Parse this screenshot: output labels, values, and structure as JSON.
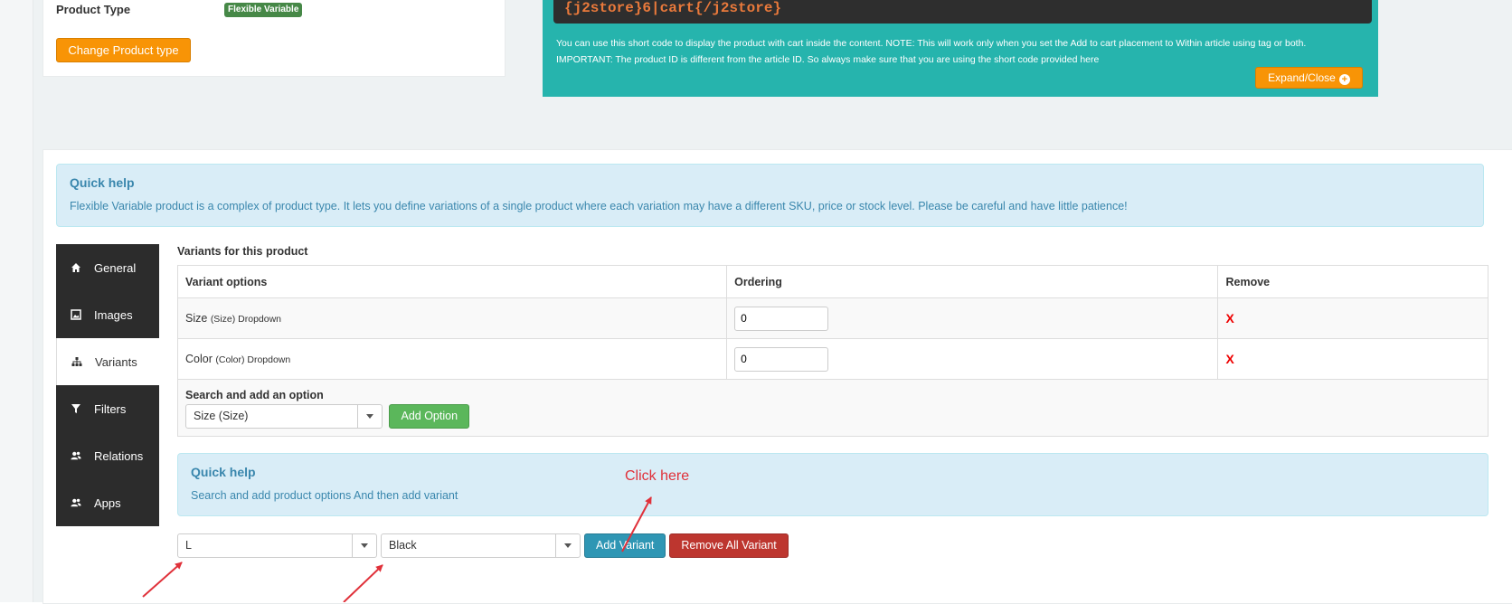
{
  "product_type": {
    "label": "Product Type",
    "badge": "Flexible Variable",
    "change_button": "Change Product type"
  },
  "shortcode": {
    "code": "{j2store}6|cart{/j2store}",
    "note1": "You can use this short code to display the product with cart inside the content. NOTE: This will work only when you set the Add to cart placement to Within article using tag or both.",
    "note2": "IMPORTANT: The product ID is different from the article ID. So always make sure that you are using the short code provided here",
    "expand_button": "Expand/Close"
  },
  "quick_help": {
    "title": "Quick help",
    "text": "Flexible Variable product is a complex of product type. It lets you define variations of a single product where each variation may have a different SKU, price or stock level. Please be careful and have little patience!"
  },
  "nav": [
    {
      "label": "General",
      "icon": "home-icon"
    },
    {
      "label": "Images",
      "icon": "image-icon"
    },
    {
      "label": "Variants",
      "icon": "sitemap-icon",
      "active": true
    },
    {
      "label": "Filters",
      "icon": "filter-icon"
    },
    {
      "label": "Relations",
      "icon": "users-icon"
    },
    {
      "label": "Apps",
      "icon": "users-icon"
    }
  ],
  "variants": {
    "title": "Variants for this product",
    "headers": {
      "options": "Variant options",
      "ordering": "Ordering",
      "remove": "Remove"
    },
    "rows": [
      {
        "name": "Size",
        "meta": "(Size) Dropdown",
        "ordering": "0",
        "remove": "X"
      },
      {
        "name": "Color",
        "meta": "(Color) Dropdown",
        "ordering": "0",
        "remove": "X"
      }
    ],
    "search_label": "Search and add an option",
    "search_selected": "Size (Size)",
    "add_option": "Add Option"
  },
  "quick_help2": {
    "title": "Quick help",
    "text": "Search and add product options And then add variant"
  },
  "annotation": {
    "text": "Click here",
    "color": "#e0313a"
  },
  "bottom": {
    "select1": "L",
    "select2": "Black",
    "add_variant": "Add Variant",
    "remove_all": "Remove All Variant"
  }
}
